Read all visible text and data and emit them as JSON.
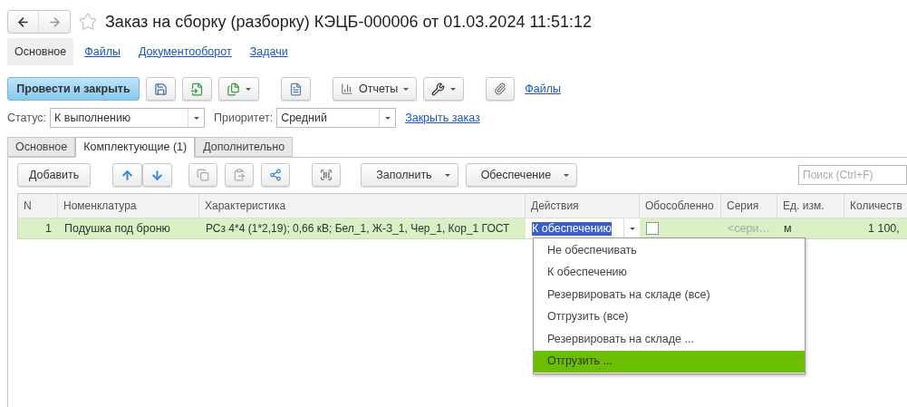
{
  "window": {
    "title": "Заказ на сборку (разборку) КЭЦБ-000006 от 01.03.2024 11:51:12",
    "starred": false
  },
  "sections": [
    {
      "label": "Основное",
      "selected": true
    },
    {
      "label": "Файлы",
      "selected": false
    },
    {
      "label": "Документооборот",
      "selected": false
    },
    {
      "label": "Задачи",
      "selected": false
    }
  ],
  "toolbar": {
    "primary": "Провести и закрыть",
    "reports": "Отчеты",
    "files_link": "Файлы"
  },
  "status": {
    "label": "Статус:",
    "value": "К выполнению"
  },
  "priority": {
    "label": "Приоритет:",
    "value": "Средний"
  },
  "close_link": "Закрыть заказ",
  "tabs": [
    {
      "label": "Основное",
      "selected": false
    },
    {
      "label": "Комплектующие (1)",
      "selected": true
    },
    {
      "label": "Дополнительно",
      "selected": false
    }
  ],
  "table_toolbar": {
    "add": "Добавить",
    "fill": "Заполнить",
    "provision": "Обеспечение",
    "search_placeholder": "Поиск (Ctrl+F)"
  },
  "table": {
    "columns": [
      "N",
      "Номенклатура",
      "Характеристика",
      "Действия",
      "Обособленно",
      "Серия",
      "Ед. изм.",
      "Количеств"
    ],
    "rows": [
      {
        "n": "1",
        "item": "Подушка под броню",
        "characteristic": "РСз 4*4 (1*2,19); 0,66 кВ; Бел_1, Ж-З_1, Чер_1, Кор_1 ГОСТ",
        "action": "К обеспечению",
        "separate": false,
        "series_placeholder": "<сери…",
        "unit": "м",
        "quantity": "1 100,",
        "selected": true
      }
    ]
  },
  "dropdown": {
    "items": [
      {
        "label": "Не обеспечивать",
        "selected": false
      },
      {
        "label": "К обеспечению",
        "selected": false
      },
      {
        "label": "Резервировать на складе (все)",
        "selected": false
      },
      {
        "label": "Отгрузить (все)",
        "selected": false
      },
      {
        "label": "Резервировать на складе ...",
        "selected": false
      },
      {
        "label": "Отгрузить ...",
        "selected": true
      }
    ]
  }
}
